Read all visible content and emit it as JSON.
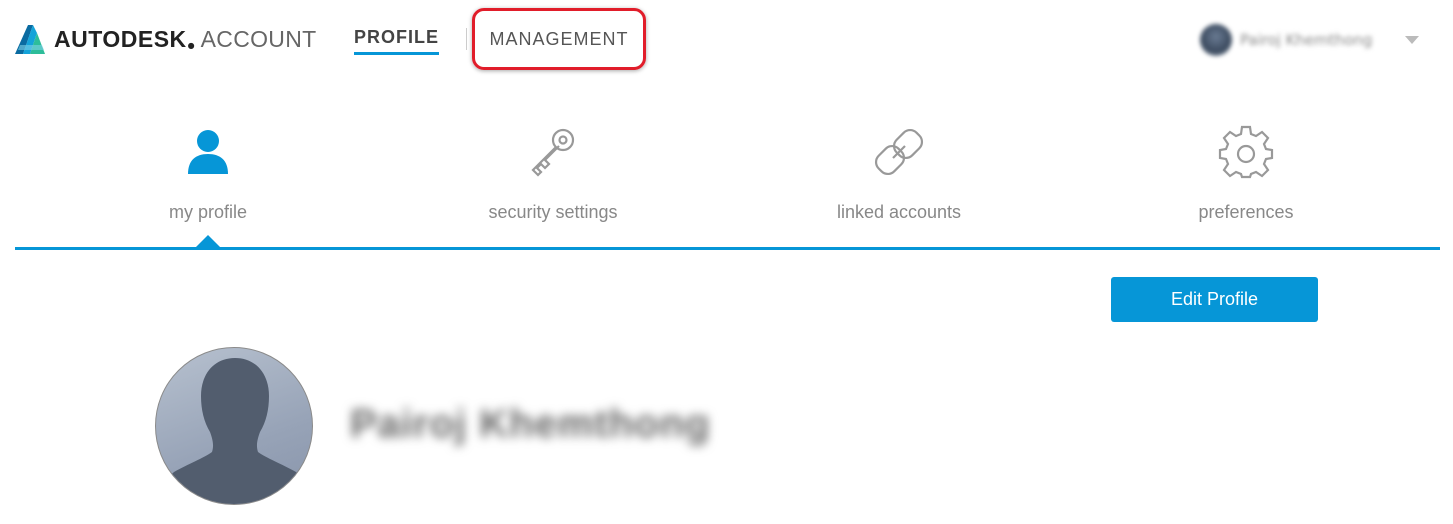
{
  "header": {
    "brand": "AUTODESK",
    "product": "ACCOUNT",
    "nav": {
      "profile": "PROFILE",
      "management": "MANAGEMENT"
    },
    "user_name": "Pairoj Khemthong"
  },
  "tabs": [
    {
      "label": "my profile",
      "icon": "person-icon",
      "active": true
    },
    {
      "label": "security settings",
      "icon": "key-icon",
      "active": false
    },
    {
      "label": "linked accounts",
      "icon": "chain-link-icon",
      "active": false
    },
    {
      "label": "preferences",
      "icon": "gear-icon",
      "active": false
    }
  ],
  "content": {
    "edit_button": "Edit Profile",
    "profile_name": "Pairoj Khemthong"
  },
  "colors": {
    "accent": "#0696d7",
    "highlight": "#e11d2a"
  }
}
